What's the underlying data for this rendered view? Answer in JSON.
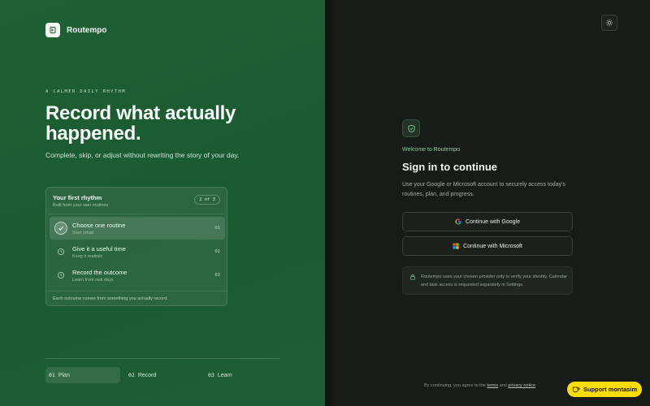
{
  "brand": {
    "name": "Routempo"
  },
  "hero": {
    "eyebrow": "A CALMER DAILY RHYTHM",
    "headline": "Record what actually happened.",
    "subtitle": "Complete, skip, or adjust without rewriting the story of your day."
  },
  "rhythm_card": {
    "title": "Your first rhythm",
    "subtitle": "Built from your own routines",
    "count": "2 of 3",
    "steps": [
      {
        "title": "Choose one routine",
        "sub": "Start small",
        "num": "01",
        "state": "done"
      },
      {
        "title": "Give it a useful time",
        "sub": "Keep it realistic",
        "num": "02",
        "state": "pending"
      },
      {
        "title": "Record the outcome",
        "sub": "Learn from real days",
        "num": "03",
        "state": "pending"
      }
    ],
    "footer": "Each outcome comes from something you actually record."
  },
  "bottom_tabs": [
    {
      "num": "01",
      "label": "Plan",
      "active": true
    },
    {
      "num": "02",
      "label": "Record",
      "active": false
    },
    {
      "num": "03",
      "label": "Learn",
      "active": false
    }
  ],
  "signin": {
    "welcome": "Welcome to Routempo",
    "title": "Sign in to continue",
    "description": "Use your Google or Microsoft account to securely access today's routines, plan, and progress.",
    "google_label": "Continue with Google",
    "microsoft_label": "Continue with Microsoft",
    "notice": "Routempo uses your chosen provider only to verify your identity. Calendar and task access is requested separately in Settings."
  },
  "legal": {
    "prefix": "By continuing, you agree to the",
    "terms": "terms",
    "and": "and",
    "privacy": "privacy notice",
    "suffix": "."
  },
  "support": {
    "label": "Support montasim"
  },
  "colors": {
    "left_panel": "#1f6034",
    "right_panel": "#181c19",
    "accent_green": "#7fd49a",
    "support_yellow": "#ffdd00"
  }
}
